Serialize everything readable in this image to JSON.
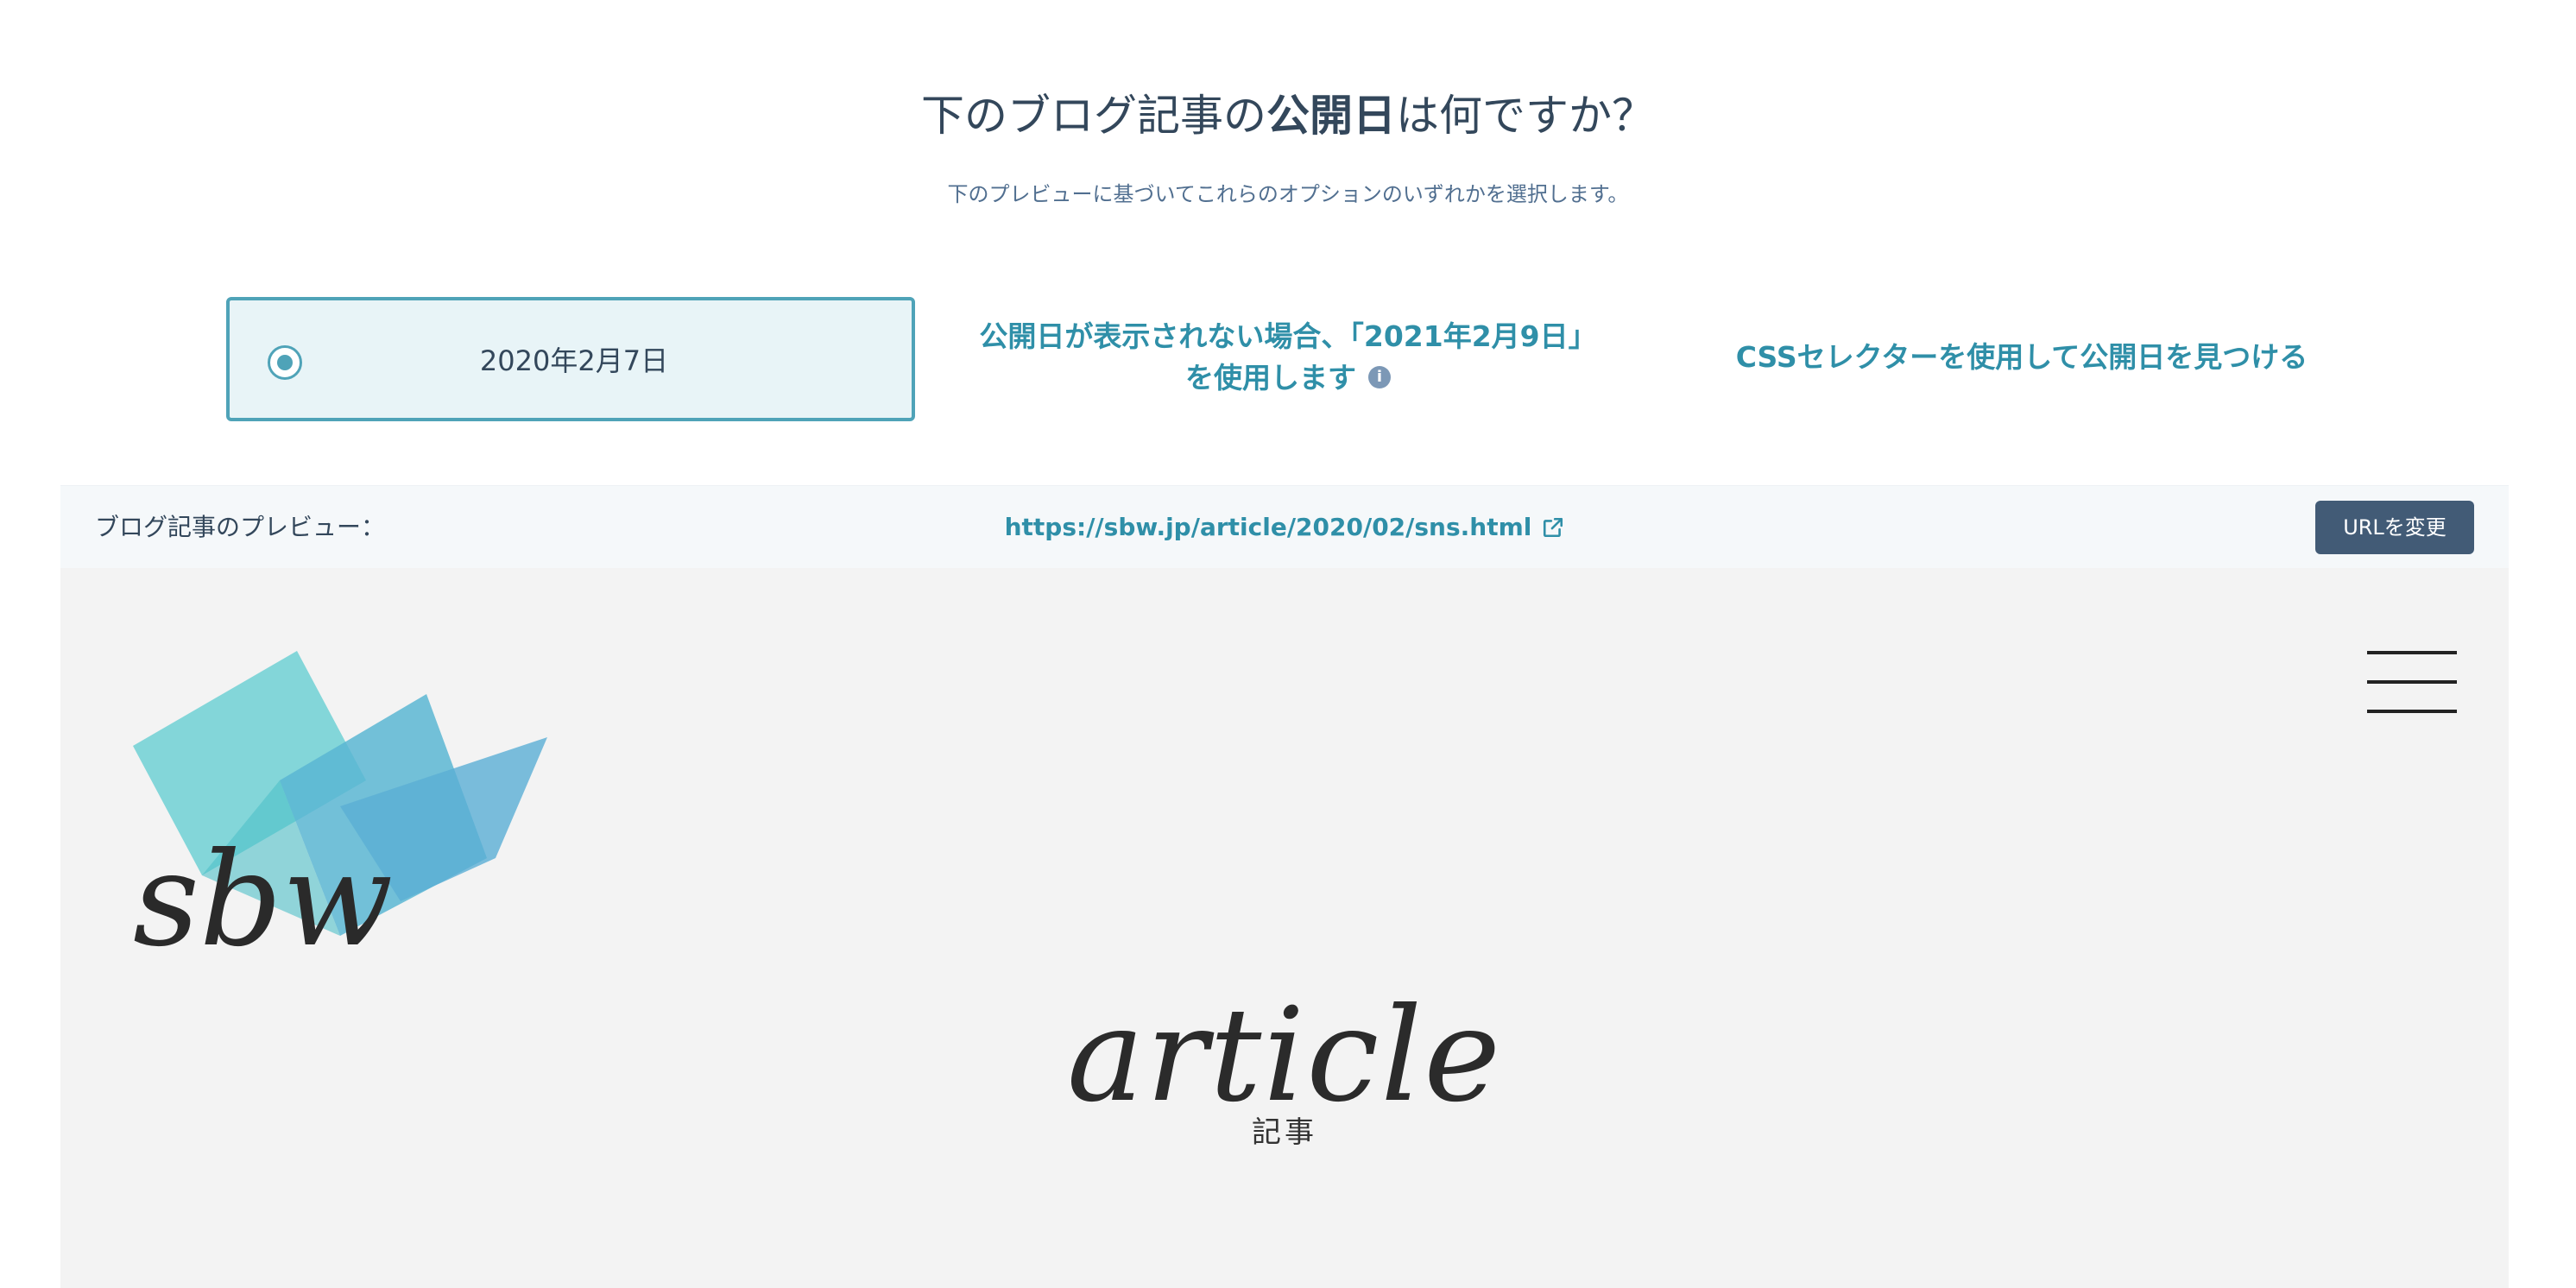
{
  "question": {
    "title_before": "下のブログ記事の",
    "title_bold": "公開日",
    "title_after": "は何ですか？",
    "subtitle": "下のプレビューに基づいてこれらのオプションのいずれかを選択します。"
  },
  "options": {
    "selected_date": "2020年2月7日",
    "fallback_line1": "公開日が表示されない場合、「2021年2月9日」",
    "fallback_line2": "を使用します",
    "css_selector": "CSSセレクターを使用して公開日を見つける"
  },
  "preview": {
    "label": "ブログ記事のプレビュー：",
    "url": "https://sbw.jp/article/2020/02/sns.html",
    "change_url_button": "URLを変更"
  },
  "site": {
    "logo_text": "sbw",
    "article_title": "article",
    "article_subtitle": "記事"
  },
  "colors": {
    "accent": "#2f8fa8",
    "selected_bg": "#e8f4f7",
    "button_bg": "#425b76",
    "text": "#33475b",
    "preview_bg": "#f3f3f3"
  },
  "icons": {
    "radio": "radio-selected-icon",
    "info": "info-icon",
    "external": "external-link-icon",
    "menu": "hamburger-menu-icon"
  }
}
